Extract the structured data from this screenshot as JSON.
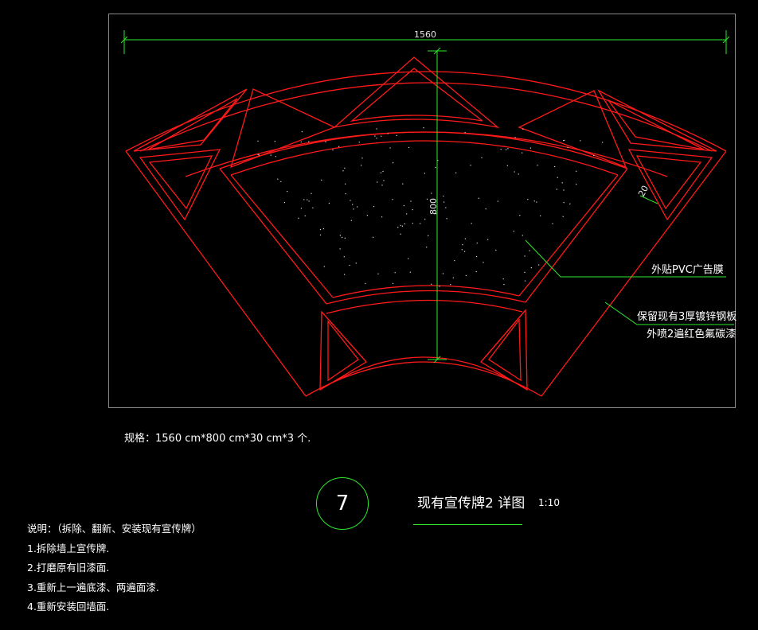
{
  "drawing": {
    "width_dim": "1560",
    "height_dim": "800",
    "thickness_dim": "20",
    "callout_pvc": "外贴PVC广告膜",
    "callout_steel_1": "保留现有3厚镀锌钢板",
    "callout_steel_2": "外喷2遍红色氟碳漆"
  },
  "spec": "规格：1560 cm*800 cm*30 cm*3 个.",
  "title": {
    "number": "7",
    "text": "现有宣传牌2 详图",
    "scale": "1:10"
  },
  "notes": {
    "heading": "说明：（拆除、翻新、安装现有宣传牌）",
    "items": [
      "1.拆除墙上宣传牌.",
      "2.打磨原有旧漆面.",
      "3.重新上一遍底漆、两遍面漆.",
      "4.重新安装回墙面."
    ]
  },
  "colors": {
    "frame_red": "#ff1a1a",
    "dim_green": "#2ee82e",
    "border_gray": "#8a8a8a"
  }
}
